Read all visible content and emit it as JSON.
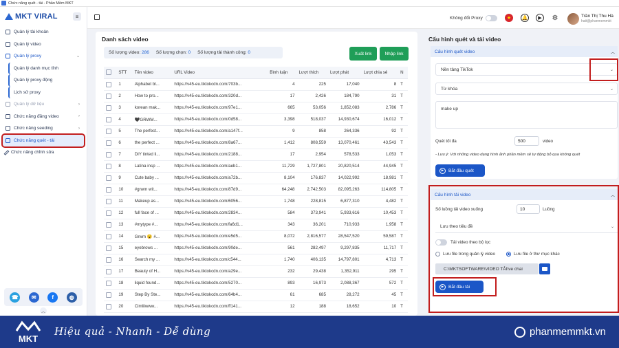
{
  "window": {
    "title": "Chức năng quét - tải - Phần Mềm MKT"
  },
  "brand": {
    "name": "MKT VIRAL"
  },
  "sidebar": {
    "items": [
      {
        "label": "Quản lý tài khoản"
      },
      {
        "label": "Quản lý video"
      },
      {
        "label": "Quản lý proxy"
      },
      {
        "label": "Quản lý danh mục tỉnh"
      },
      {
        "label": "Quản lý proxy động"
      },
      {
        "label": "Lịch sử proxy"
      },
      {
        "label": "Quản lý dữ liệu"
      },
      {
        "label": "Chức năng đăng video"
      },
      {
        "label": "Chức năng seeding"
      },
      {
        "label": "Chức năng quét - tải"
      },
      {
        "label": "Chức năng chỉnh sửa"
      }
    ]
  },
  "topbar": {
    "proxy_label": "Không đổi Proxy",
    "user_name": "Trần Thị Thu Hà",
    "user_email": "hatt@phanmemmkt"
  },
  "left": {
    "title": "Danh sách video",
    "stats": {
      "total_label": "Số lượng video:",
      "total": "286",
      "selected_label": "Số lượng chọn:",
      "selected": "0",
      "downloaded_label": "Số lượng tải thành công:",
      "downloaded": "0"
    },
    "export_label": "Xuất link",
    "import_label": "Nhập link",
    "columns": [
      "STT",
      "Tên video",
      "URL Video",
      "Bình luận",
      "Lượt thích",
      "Lượt phát",
      "Lượt chia sẻ",
      "N"
    ],
    "rows": [
      [
        "1",
        "Alphabet bl...",
        "https://v45-eu.tiktokcdn.com/703b...",
        "4",
        "225",
        "17,040",
        "8",
        "T"
      ],
      [
        "2",
        "How to pro...",
        "https://v45-eu.tiktokcdn.com/320d...",
        "17",
        "2,426",
        "184,790",
        "31",
        "T"
      ],
      [
        "3",
        "korean mak...",
        "https://v45-eu.tiktokcdn.com/97e1...",
        "665",
        "53,056",
        "1,852,083",
        "2,786",
        "T"
      ],
      [
        "4",
        "🖤GRWM...",
        "https://v45-eu.tiktokcdn.com/0d58...",
        "3,398",
        "518,037",
        "14,930,674",
        "16,012",
        "T"
      ],
      [
        "5",
        "The perfect...",
        "https://v45-eu.tiktokcdn.com/a147f...",
        "9",
        "858",
        "264,336",
        "92",
        "T"
      ],
      [
        "6",
        "the perfect ...",
        "https://v45-eu.tiktokcdn.com/8a67...",
        "1,412",
        "808,559",
        "13,070,461",
        "43,543",
        "T"
      ],
      [
        "7",
        "DIY tinted li...",
        "https://v45-eu.tiktokcdn.com/2188...",
        "17",
        "2,954",
        "578,533",
        "1,053",
        "T"
      ],
      [
        "8",
        "Latina insp ...",
        "https://v45-eu.tiktokcdn.com/aeb1...",
        "11,729",
        "1,727,801",
        "20,820,514",
        "44,945",
        "T"
      ],
      [
        "9",
        "Cute baby ...",
        "https://v45-eu.tiktokcdn.com/a72b...",
        "8,104",
        "176,837",
        "14,022,992",
        "18,981",
        "T"
      ],
      [
        "10",
        "#grwm wit...",
        "https://v45-eu.tiktokcdn.com/87d9...",
        "64,248",
        "2,742,503",
        "82,095,263",
        "114,805",
        "T"
      ],
      [
        "11",
        "Makeup as...",
        "https://v45-eu.tiktokcdn.com/6056...",
        "1,748",
        "228,815",
        "6,877,310",
        "4,482",
        "T"
      ],
      [
        "12",
        "full face of ...",
        "https://v45-eu.tiktokcdn.com/2834...",
        "584",
        "373,941",
        "5,933,616",
        "10,453",
        "T"
      ],
      [
        "13",
        "#mytype #...",
        "https://v45-eu.tiktokcdn.com/fa6d1...",
        "343",
        "36,201",
        "710,933",
        "1,958",
        "T"
      ],
      [
        "14",
        "Grwm 😮 #...",
        "https://v45-eu.tiktokcdn.com/e5d5...",
        "8,072",
        "2,816,577",
        "28,547,520",
        "59,587",
        "T"
      ],
      [
        "15",
        "eyebrows ...",
        "https://v45-eu.tiktokcdn.com/90de...",
        "561",
        "282,497",
        "9,297,835",
        "11,717",
        "T"
      ],
      [
        "16",
        "Search my ...",
        "https://v45-eu.tiktokcdn.com/c544...",
        "1,740",
        "406,135",
        "14,797,801",
        "4,713",
        "T"
      ],
      [
        "17",
        "Beauty of H...",
        "https://v45-eu.tiktokcdn.com/a29e...",
        "232",
        "29,438",
        "1,352,911",
        "295",
        "T"
      ],
      [
        "18",
        "liquid found...",
        "https://v45-eu.tiktokcdn.com/5270...",
        "893",
        "16,973",
        "2,088,367",
        "572",
        "T"
      ],
      [
        "19",
        "Step By Ste...",
        "https://v45-eu.tiktokcdn.com/64b4...",
        "61",
        "685",
        "28,272",
        "45",
        "T"
      ],
      [
        "20",
        "Cimliiwww...",
        "https://v45-eu.tiktokcdn.com/ff141...",
        "12",
        "188",
        "18,652",
        "10",
        "T"
      ]
    ]
  },
  "right": {
    "title": "Cấu hình quét và tải video",
    "scan": {
      "header": "Cấu hình quét video",
      "platform": "Nền tảng TikTok",
      "keyword_placeholder": "Từ khóa",
      "keywords": "make up",
      "max_label": "Quét tối đa",
      "max_value": "500",
      "max_unit": "video",
      "note": "- Lưu ý: Với những video dạng hình ảnh phần mềm sẽ tự động bỏ qua không quét",
      "start_label": "Bắt đầu quét"
    },
    "download": {
      "header": "Cấu hình tải video",
      "threads_label": "Số luồng tải video xuống",
      "threads_value": "10",
      "threads_unit": "Luồng",
      "save_option": "Lưu theo tiêu đề",
      "filter_label": "Tải video theo bộ lọc",
      "radio1": "Lưu file trong quản lý video",
      "radio2": "Lưu file ở thư mục khác",
      "path": "C:\\MKTSOFTWARE\\VIDEO TẢI\\ve chai",
      "start_label": "Bắt đầu tải"
    }
  },
  "banner": {
    "slogan": "Hiệu quả - Nhanh  - Dễ dùng",
    "site": "phanmemmkt.vn",
    "logo": "MKT"
  },
  "colors": {
    "accent": "#1b56c7",
    "green": "#1f9e58",
    "highlight": "#c21d1d",
    "banner": "#1e3a8a"
  }
}
